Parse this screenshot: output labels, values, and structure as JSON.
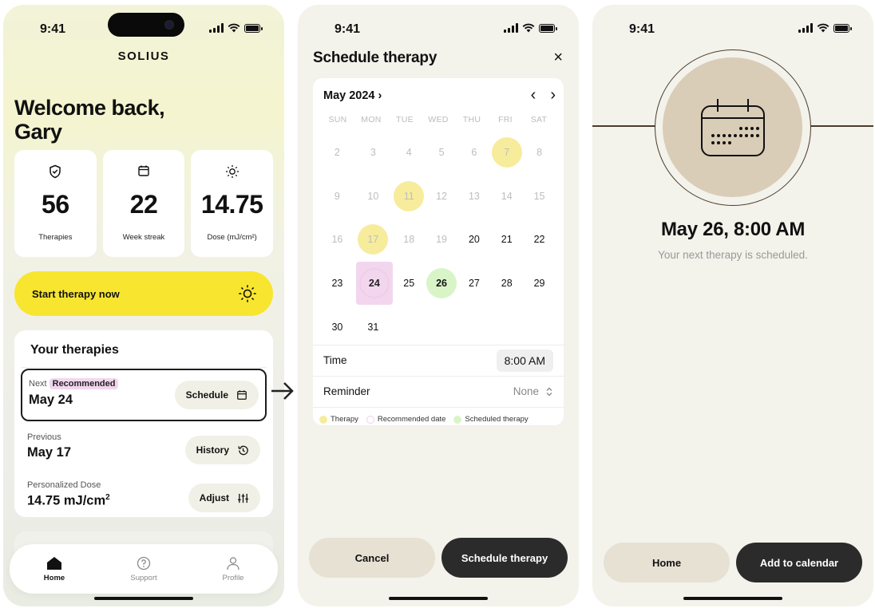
{
  "status": {
    "time": "9:41"
  },
  "home": {
    "logo": "SOLIUS",
    "welcome": "Welcome back, Gary",
    "stats": [
      {
        "icon": "shield-check-icon",
        "value": "56",
        "label": "Therapies"
      },
      {
        "icon": "calendar-icon",
        "value": "22",
        "label": "Week streak"
      },
      {
        "icon": "sun-icon",
        "value": "14.75",
        "label": "Dose (mJ/cm²)"
      }
    ],
    "start_button": "Start therapy now",
    "therapies_title": "Your therapies",
    "next": {
      "label": "Next",
      "badge": "Recommended",
      "value": "May 24",
      "button": "Schedule"
    },
    "previous": {
      "label": "Previous",
      "value": "May 17",
      "button": "History"
    },
    "dose": {
      "label": "Personalized Dose",
      "value": "14.75 mJ/cm",
      "sup": "2",
      "button": "Adjust"
    },
    "tabs": {
      "home": "Home",
      "support": "Support",
      "profile": "Profile"
    }
  },
  "schedule": {
    "title": "Schedule therapy",
    "close": "×",
    "month": "May 2024 ›",
    "weekdays": [
      "SUN",
      "MON",
      "TUE",
      "WED",
      "THU",
      "FRI",
      "SAT"
    ],
    "days": [
      {
        "d": "2",
        "s": "past"
      },
      {
        "d": "3",
        "s": "past"
      },
      {
        "d": "4",
        "s": "past"
      },
      {
        "d": "5",
        "s": "past"
      },
      {
        "d": "6",
        "s": "past"
      },
      {
        "d": "7",
        "s": "past ther"
      },
      {
        "d": "8",
        "s": "past"
      },
      {
        "d": "9",
        "s": "past"
      },
      {
        "d": "10",
        "s": "past"
      },
      {
        "d": "11",
        "s": "past ther"
      },
      {
        "d": "12",
        "s": "past"
      },
      {
        "d": "13",
        "s": "past"
      },
      {
        "d": "14",
        "s": "past"
      },
      {
        "d": "15",
        "s": "past"
      },
      {
        "d": "16",
        "s": "past"
      },
      {
        "d": "17",
        "s": "past ther"
      },
      {
        "d": "18",
        "s": "past"
      },
      {
        "d": "19",
        "s": "past"
      },
      {
        "d": "20",
        "s": ""
      },
      {
        "d": "21",
        "s": ""
      },
      {
        "d": "22",
        "s": ""
      },
      {
        "d": "23",
        "s": ""
      },
      {
        "d": "24",
        "s": "reco"
      },
      {
        "d": "25",
        "s": ""
      },
      {
        "d": "26",
        "s": "sched"
      },
      {
        "d": "27",
        "s": ""
      },
      {
        "d": "28",
        "s": ""
      },
      {
        "d": "29",
        "s": ""
      },
      {
        "d": "30",
        "s": ""
      },
      {
        "d": "31",
        "s": ""
      }
    ],
    "time_label": "Time",
    "time_value": "8:00 AM",
    "reminder_label": "Reminder",
    "reminder_value": "None",
    "legend": {
      "therapy": "Therapy",
      "recommended": "Recommended date",
      "scheduled": "Scheduled therapy"
    },
    "colors": {
      "therapy": "#f7ec9c",
      "recommended": "#f0cdea",
      "scheduled": "#d9f5c8"
    },
    "cancel": "Cancel",
    "confirm": "Schedule therapy"
  },
  "confirmation": {
    "date": "May 26, 8:00 AM",
    "subtitle": "Your next therapy is scheduled.",
    "home_button": "Home",
    "calendar_button": "Add to calendar"
  }
}
